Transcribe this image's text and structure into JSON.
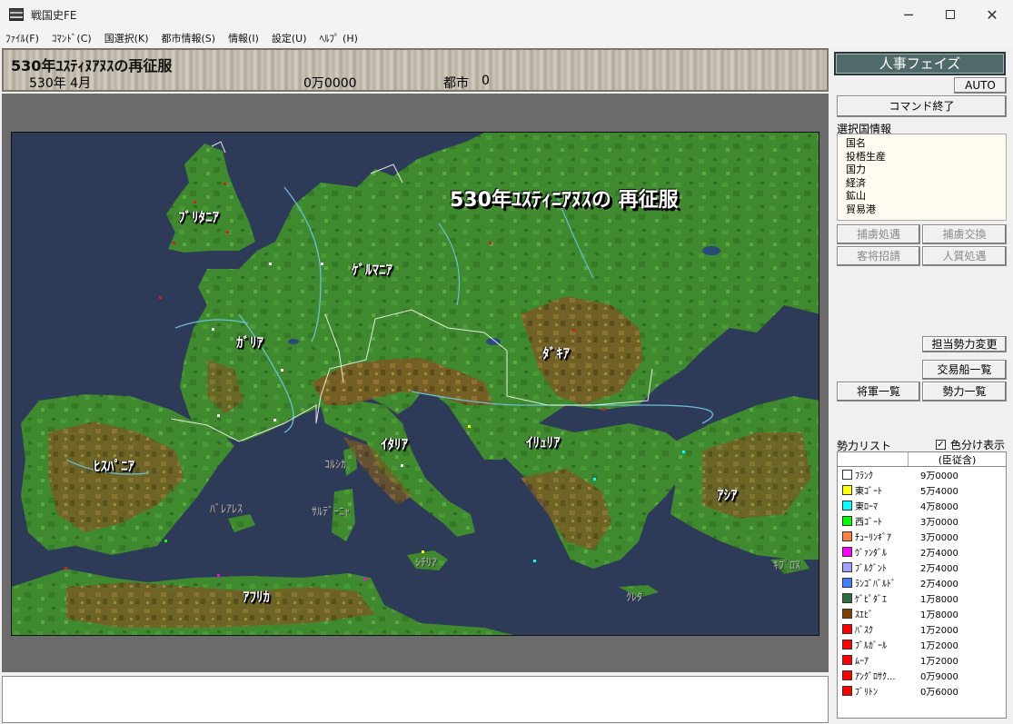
{
  "window": {
    "title": "戦国史FE"
  },
  "menu": [
    "ﾌｧｲﾙ(F)",
    "ｺﾏﾝﾄﾞ(C)",
    "国選択(K)",
    "都市情報(S)",
    "情報(I)",
    "設定(U)",
    "ﾍﾙﾌﾟ (H)"
  ],
  "header": {
    "scenario": "530年ﾕｽﾃｨﾇｱﾇｽの再征服",
    "date": "530年  4月",
    "gold": "0万0000",
    "city_label": "都市",
    "city_count": "0"
  },
  "map": {
    "title": "530年ﾕｽﾃｨﾆｱﾇｽの 再征服",
    "regions": [
      "ﾌﾞﾘﾀﾆｱ",
      "ｹﾞﾙﾏﾆｱ",
      "ｶﾞﾘｱ",
      "ﾀﾞｷｱ",
      "ｲﾀﾘｱ",
      "ｲﾘｭﾘｱ",
      "ﾋｽﾊﾟﾆｱ",
      "ｱｼｱ",
      "ｱﾌﾘｶ"
    ],
    "islands": [
      "ｺﾙｼｶ",
      "ﾊﾞﾚｱﾚｽ",
      "ｻﾙﾃﾞｰﾆｬ",
      "ｼﾁﾘｱ",
      "ｸﾚﾀ",
      "ｷﾌﾟﾛｽ"
    ]
  },
  "panel": {
    "phase": "人事フェイズ",
    "auto": "AUTO",
    "end_command": "コマンド終了",
    "selected_label": "選択国情報",
    "selected_fields": [
      "国名",
      "投梧生産",
      "国力",
      "経済",
      "鉱山",
      "貿易港"
    ],
    "buttons": {
      "captive_treat": "捕虜処遇",
      "captive_swap": "捕虜交換",
      "guest": "客将招請",
      "hostage": "人質処遇",
      "change_force": "担当勢力変更",
      "trade_ships": "交易船一覧",
      "generals": "将軍一覧",
      "forces": "勢力一覧"
    },
    "forces_label": "勢力リスト",
    "color_toggle": "色分け表示",
    "color_checked": "✓",
    "forces_header": "(臣従含)",
    "forces": [
      {
        "name": "ﾌﾗﾝｸ",
        "value": "9万0000",
        "color": "#ffffff"
      },
      {
        "name": "東ｺﾞｰﾄ",
        "value": "5万4000",
        "color": "#ffff00"
      },
      {
        "name": "東ﾛｰﾏ",
        "value": "4万8000",
        "color": "#00ffff"
      },
      {
        "name": "西ｺﾞｰﾄ",
        "value": "3万0000",
        "color": "#00ff00"
      },
      {
        "name": "ﾁｭｰﾘﾝｷﾞｱ",
        "value": "3万0000",
        "color": "#ff8040"
      },
      {
        "name": "ｳﾞｧﾝﾀﾞﾙ",
        "value": "2万4000",
        "color": "#ff00ff"
      },
      {
        "name": "ﾌﾞﾙｸﾞﾝﾄ",
        "value": "2万4000",
        "color": "#a0a0ff"
      },
      {
        "name": "ﾗﾝｺﾞﾊﾞﾙﾄﾞ",
        "value": "2万4000",
        "color": "#4080ff"
      },
      {
        "name": "ｹﾞﾋﾟﾀﾞｴ",
        "value": "1万8000",
        "color": "#2f6f3f"
      },
      {
        "name": "ｽｴﾋﾞ",
        "value": "1万8000",
        "color": "#804000"
      },
      {
        "name": "ﾊﾞｽｸ",
        "value": "1万2000",
        "color": "#ff0000"
      },
      {
        "name": "ﾌﾞﾙｶﾞｰﾙ",
        "value": "1万2000",
        "color": "#ff0000"
      },
      {
        "name": "ﾑｰｱ",
        "value": "1万2000",
        "color": "#ff0000"
      },
      {
        "name": "ｱﾝｸﾞﾛｻｸ...",
        "value": "0万9000",
        "color": "#ff0000"
      },
      {
        "name": "ﾌﾞﾘﾄﾝ",
        "value": "0万6000",
        "color": "#ff0000"
      }
    ]
  }
}
